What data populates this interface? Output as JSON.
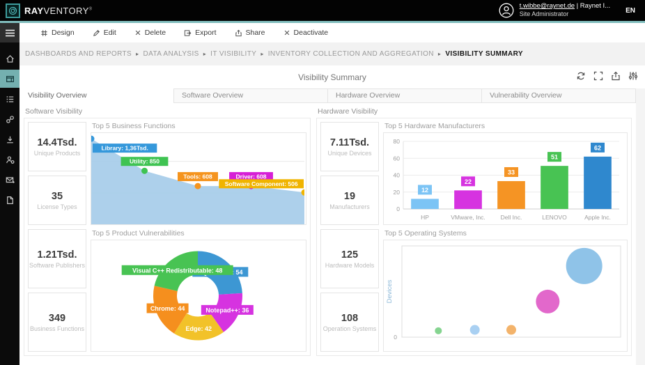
{
  "header": {
    "logo": {
      "brand_bold": "RAY",
      "brand_light": "VENTORY",
      "trademark": "®"
    },
    "user": {
      "email": "t.wibbe@raynet.de",
      "org_suffix": " | Raynet I...",
      "role": "Site Administrator",
      "language": "EN"
    }
  },
  "toolbar": {
    "items": [
      {
        "label": "Design",
        "icon": "design-icon"
      },
      {
        "label": "Edit",
        "icon": "edit-icon"
      },
      {
        "label": "Delete",
        "icon": "delete-icon"
      },
      {
        "label": "Export",
        "icon": "export-icon"
      },
      {
        "label": "Share",
        "icon": "share-icon"
      },
      {
        "label": "Deactivate",
        "icon": "deactivate-icon"
      }
    ]
  },
  "sidebar": {
    "items": [
      {
        "name": "home",
        "active": false
      },
      {
        "name": "dashboards",
        "active": true
      },
      {
        "name": "reports-list",
        "active": false
      },
      {
        "name": "tags",
        "active": false
      },
      {
        "name": "downloads",
        "active": false
      },
      {
        "name": "user-management",
        "active": false
      },
      {
        "name": "messages",
        "active": false
      },
      {
        "name": "documents",
        "active": false
      }
    ]
  },
  "breadcrumb": {
    "separator": "▸",
    "items": [
      "DASHBOARDS AND REPORTS",
      "DATA ANALYSIS",
      "IT VISIBILITY",
      "INVENTORY COLLECTION AND AGGREGATION",
      "VISIBILITY SUMMARY"
    ]
  },
  "page": {
    "title": "Visibility Summary",
    "actions": [
      "refresh-icon",
      "fullscreen-icon",
      "export-up-icon",
      "sliders-icon"
    ]
  },
  "tabs": [
    {
      "label": "Visibility Overview",
      "active": true
    },
    {
      "label": "Software Overview",
      "active": false
    },
    {
      "label": "Hardware Overview",
      "active": false
    },
    {
      "label": "Vulnerability Overview",
      "active": false
    }
  ],
  "sections": {
    "software": {
      "title": "Software Visibility",
      "stats": [
        {
          "value": "14.4Tsd.",
          "label": "Unique Products"
        },
        {
          "value": "35",
          "label": "License Types"
        },
        {
          "value": "1.21Tsd.",
          "label": "Software Publishers"
        },
        {
          "value": "349",
          "label": "Business Functions"
        }
      ]
    },
    "hardware": {
      "title": "Hardware Visibility",
      "stats": [
        {
          "value": "7.11Tsd.",
          "label": "Unique Devices"
        },
        {
          "value": "19",
          "label": "Manufacturers"
        },
        {
          "value": "125",
          "label": "Hardware Models"
        },
        {
          "value": "108",
          "label": "Operation Systems"
        }
      ]
    }
  },
  "chart_data": [
    {
      "id": "business-functions",
      "type": "area",
      "title": "Top 5 Business Functions",
      "ylim": [
        0,
        1450
      ],
      "gridlines": [
        500,
        1000
      ],
      "area_color": "#a6cce9",
      "points": [
        {
          "label": "Library",
          "value": 1360,
          "display": "Library: 1,36Tsd.",
          "color": "#3598db"
        },
        {
          "label": "Utility",
          "value": 850,
          "display": "Utility: 850",
          "color": "#3fc352"
        },
        {
          "label": "Tools",
          "value": 608,
          "display": "Tools: 608",
          "color": "#f5941e"
        },
        {
          "label": "Driver",
          "value": 608,
          "display": "Driver: 608",
          "color": "#d61fd6"
        },
        {
          "label": "Software Component",
          "value": 506,
          "display": "Software Component: 506",
          "color": "#f0b400"
        }
      ]
    },
    {
      "id": "product-vulnerabilities",
      "type": "donut",
      "title": "Top 5 Product Vulnerabilities",
      "slices": [
        {
          "label": "SQL Server",
          "value": 54,
          "color": "#3d97d3"
        },
        {
          "label": "Notepad++",
          "value": 36,
          "color": "#d633e0"
        },
        {
          "label": "Edge",
          "value": 42,
          "color": "#f2c229"
        },
        {
          "label": "Chrome",
          "value": 44,
          "color": "#f58f1e"
        },
        {
          "label": "Visual C++ Redistributable",
          "value": 48,
          "color": "#48c353"
        }
      ]
    },
    {
      "id": "hardware-manufacturers",
      "type": "bar",
      "title": "Top 5 Hardware Manufacturers",
      "ylim": [
        0,
        80
      ],
      "yticks": [
        0,
        20,
        40,
        60,
        80
      ],
      "categories": [
        "HP",
        "VMware, Inc.",
        "Dell Inc.",
        "LENOVO",
        "Apple Inc."
      ],
      "values": [
        12,
        22,
        33,
        51,
        62
      ],
      "colors": [
        "#7cc4f5",
        "#d633e0",
        "#f59424",
        "#48c353",
        "#2f88ce"
      ]
    },
    {
      "id": "operating-systems",
      "type": "bubble",
      "title": "Top 5 Operating Systems",
      "ylabel": "Devices",
      "ylim": [
        0,
        100
      ],
      "yticks": [
        0
      ],
      "xmax": 6,
      "points": [
        {
          "x": 1,
          "y": 7,
          "r": 5,
          "color": "#85d490"
        },
        {
          "x": 2,
          "y": 8,
          "r": 7,
          "color": "#a9d0f2"
        },
        {
          "x": 3,
          "y": 8,
          "r": 7,
          "color": "#f3b36b"
        },
        {
          "x": 4,
          "y": 39,
          "r": 17,
          "color": "#e268cb"
        },
        {
          "x": 5,
          "y": 78,
          "r": 26,
          "color": "#8fc3e8"
        }
      ]
    }
  ]
}
